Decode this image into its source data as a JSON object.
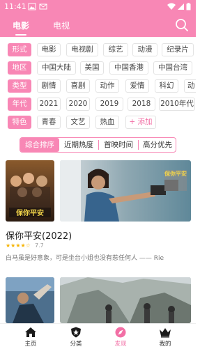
{
  "status": {
    "time": "11:41"
  },
  "header": {
    "tabs": [
      {
        "label": "电影",
        "active": true
      },
      {
        "label": "电视",
        "active": false
      }
    ],
    "accent": "#f887b5"
  },
  "filters": {
    "rows": [
      {
        "label": "形式",
        "options": [
          "电影",
          "电视剧",
          "综艺",
          "动漫",
          "纪录片"
        ]
      },
      {
        "label": "地区",
        "options": [
          "中国大陆",
          "美国",
          "中国香港",
          "中国台湾"
        ]
      },
      {
        "label": "类型",
        "options": [
          "剧情",
          "喜剧",
          "动作",
          "爱情",
          "科幻",
          "动"
        ]
      },
      {
        "label": "年代",
        "options": [
          "2021",
          "2020",
          "2019",
          "2018",
          "2010年代"
        ]
      },
      {
        "label": "特色",
        "options": [
          "青春",
          "文艺",
          "热血"
        ],
        "add": "+ 添加"
      }
    ]
  },
  "sort": {
    "options": [
      "综合排序",
      "近期热度",
      "首映时间",
      "高分优先"
    ],
    "active_index": 0
  },
  "movie": {
    "title": "保你平安(2022)",
    "stars": "★★★★☆",
    "rating": "7.7",
    "quote": "白马虽是好意象，可是坐台小姐也没有惹任何人 —— Rie",
    "poster_text": "保你平安",
    "still_text": "保你平安"
  },
  "nav": [
    {
      "label": "主页",
      "icon": "home-icon",
      "active": false
    },
    {
      "label": "分类",
      "icon": "shield-icon",
      "active": false
    },
    {
      "label": "发现",
      "icon": "compass-icon",
      "active": true
    },
    {
      "label": "我的",
      "icon": "crown-icon",
      "active": false
    }
  ]
}
